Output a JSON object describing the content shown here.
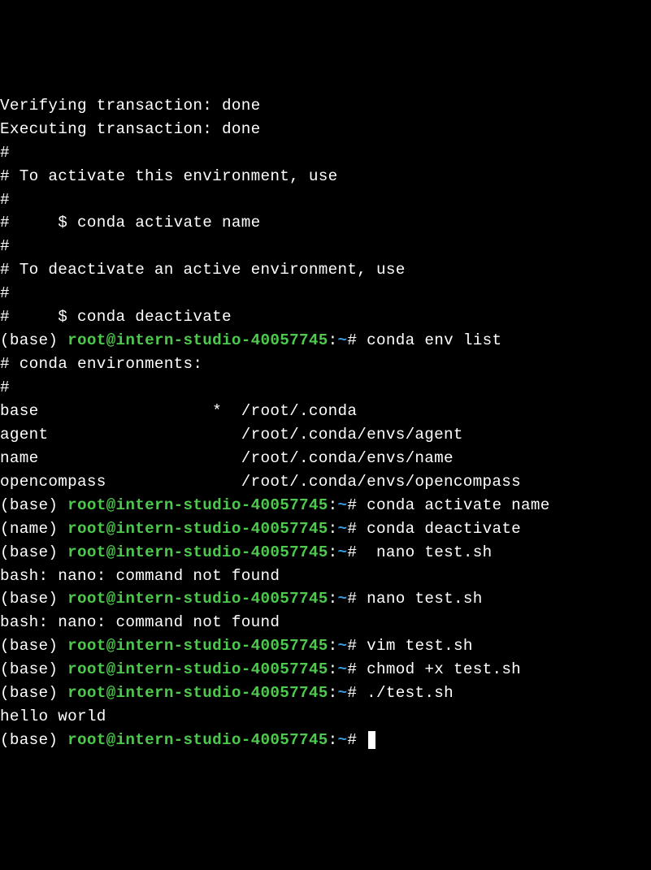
{
  "lines": {
    "l0": "Verifying transaction: done",
    "l1": "Executing transaction: done",
    "l2": "#",
    "l3": "# To activate this environment, use",
    "l4": "#",
    "l5": "#     $ conda activate name",
    "l6": "#",
    "l7": "# To deactivate an active environment, use",
    "l8": "#",
    "l9": "#     $ conda deactivate",
    "l10": ""
  },
  "prompt": {
    "env_base": "(base) ",
    "env_name": "(name) ",
    "user_host": "root@intern-studio-40057745",
    "colon": ":",
    "path": "~",
    "hash": "# "
  },
  "commands": {
    "c1": "conda env list",
    "c2": "conda activate name",
    "c3": "conda deactivate",
    "c4": " nano test.sh",
    "c5": "nano test.sh",
    "c6": "vim test.sh",
    "c7": "chmod +x test.sh",
    "c8": "./test.sh"
  },
  "output": {
    "env_header": "# conda environments:",
    "env_hash": "#",
    "env_base": "base                  *  /root/.conda",
    "env_agent": "agent                    /root/.conda/envs/agent",
    "env_name": "name                     /root/.conda/envs/name",
    "env_opencompass": "opencompass              /root/.conda/envs/opencompass",
    "empty": "",
    "nano_err": "bash: nano: command not found",
    "hello": "hello world"
  }
}
